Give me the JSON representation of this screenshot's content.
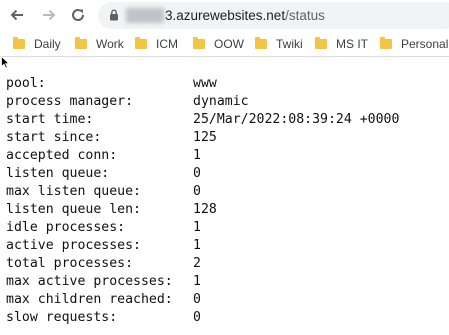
{
  "browser": {
    "url_host_suffix": "3.azurewebsites.net",
    "url_path": "/status"
  },
  "bookmarks": [
    "Daily",
    "Work",
    "ICM",
    "OOW",
    "Twiki",
    "MS IT",
    "Personal"
  ],
  "status_rows": [
    {
      "key": "pool:",
      "value": "www"
    },
    {
      "key": "process manager:",
      "value": "dynamic"
    },
    {
      "key": "start time:",
      "value": "25/Mar/2022:08:39:24 +0000"
    },
    {
      "key": "start since:",
      "value": "125"
    },
    {
      "key": "accepted conn:",
      "value": "1"
    },
    {
      "key": "listen queue:",
      "value": "0"
    },
    {
      "key": "max listen queue:",
      "value": "0"
    },
    {
      "key": "listen queue len:",
      "value": "128"
    },
    {
      "key": "idle processes:",
      "value": "1"
    },
    {
      "key": "active processes:",
      "value": "1"
    },
    {
      "key": "total processes:",
      "value": "2"
    },
    {
      "key": "max active processes:",
      "value": "1"
    },
    {
      "key": "max children reached:",
      "value": "0"
    },
    {
      "key": "slow requests:",
      "value": "0"
    }
  ],
  "colors": {
    "folder": "#f4c542",
    "omnibox_bg": "#f1f3f4"
  }
}
